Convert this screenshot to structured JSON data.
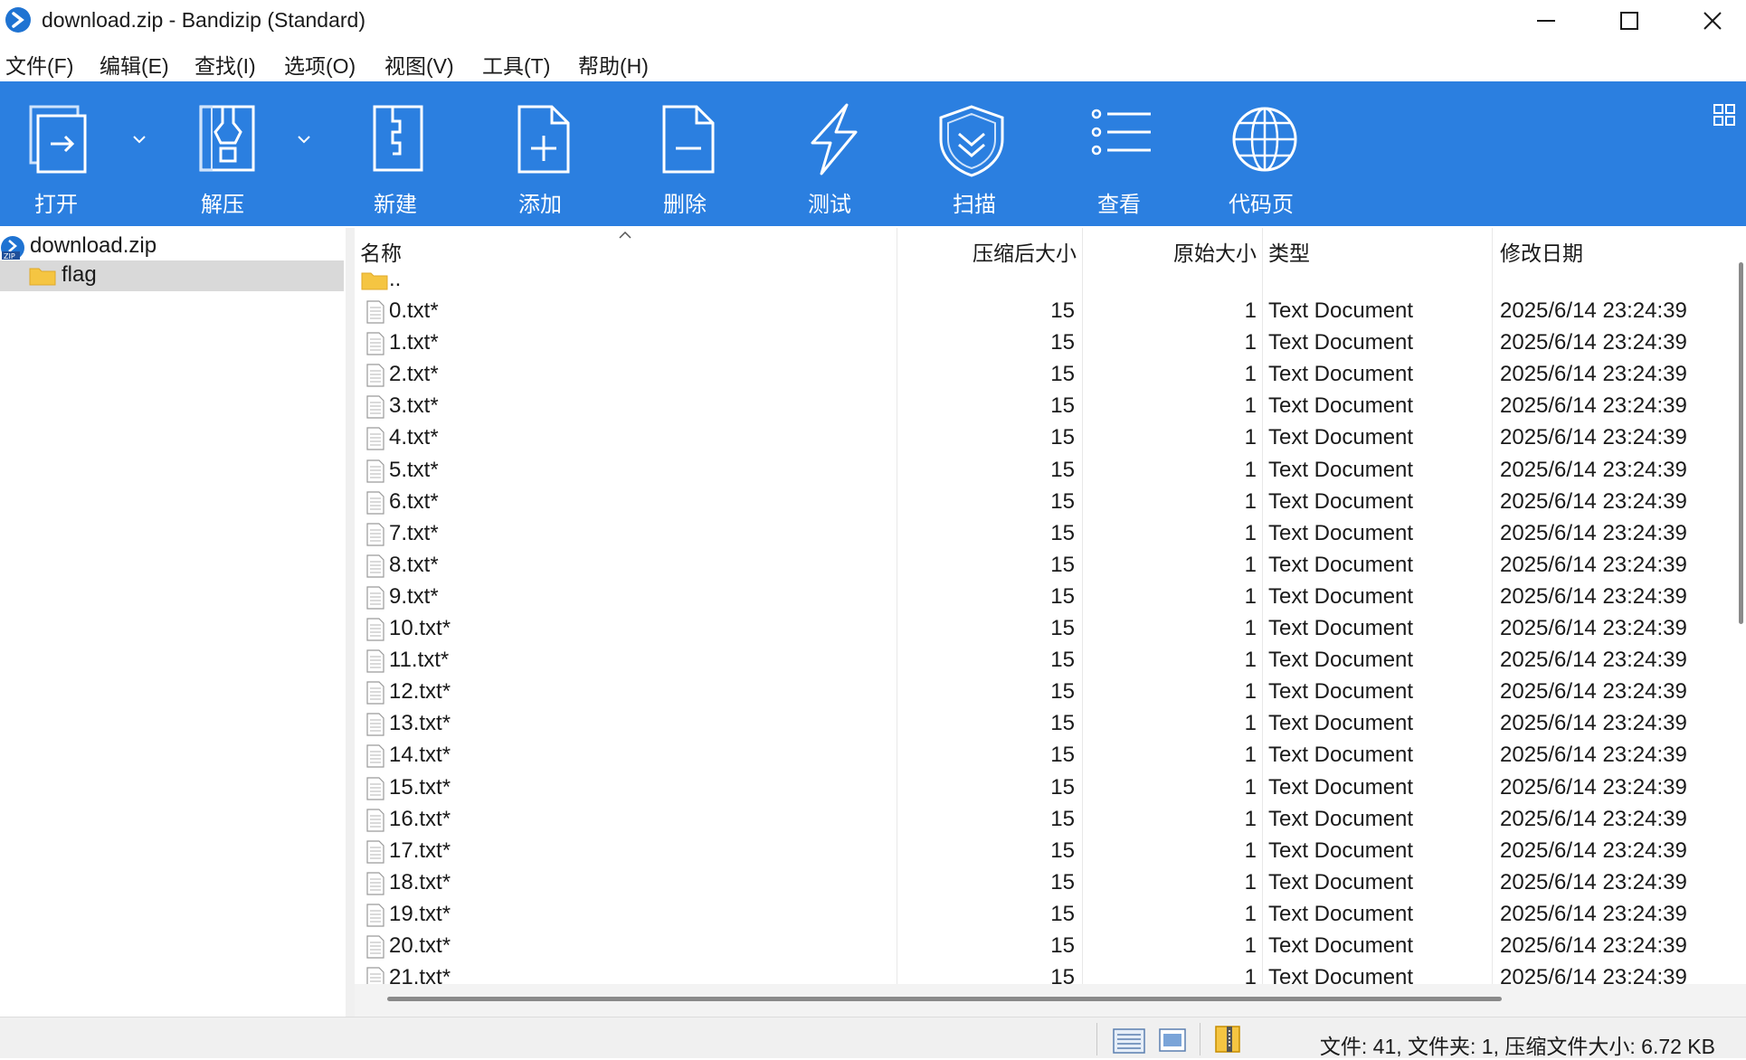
{
  "window": {
    "title": "download.zip - Bandizip (Standard)"
  },
  "menu": [
    "文件(F)",
    "编辑(E)",
    "查找(I)",
    "选项(O)",
    "视图(V)",
    "工具(T)",
    "帮助(H)"
  ],
  "toolbar": {
    "open": "打开",
    "extract": "解压",
    "new": "新建",
    "add": "添加",
    "delete": "删除",
    "test": "测试",
    "scan": "扫描",
    "view": "查看",
    "codepage": "代码页"
  },
  "tree": {
    "root": "download.zip",
    "folder": "flag"
  },
  "columns": {
    "name": "名称",
    "compressed": "压缩后大小",
    "original": "原始大小",
    "type": "类型",
    "modified": "修改日期"
  },
  "parent_dir": "..",
  "files": [
    {
      "name": "0.txt*",
      "compressed": "15",
      "original": "1",
      "type": "Text Document",
      "modified": "2025/6/14 23:24:39"
    },
    {
      "name": "1.txt*",
      "compressed": "15",
      "original": "1",
      "type": "Text Document",
      "modified": "2025/6/14 23:24:39"
    },
    {
      "name": "2.txt*",
      "compressed": "15",
      "original": "1",
      "type": "Text Document",
      "modified": "2025/6/14 23:24:39"
    },
    {
      "name": "3.txt*",
      "compressed": "15",
      "original": "1",
      "type": "Text Document",
      "modified": "2025/6/14 23:24:39"
    },
    {
      "name": "4.txt*",
      "compressed": "15",
      "original": "1",
      "type": "Text Document",
      "modified": "2025/6/14 23:24:39"
    },
    {
      "name": "5.txt*",
      "compressed": "15",
      "original": "1",
      "type": "Text Document",
      "modified": "2025/6/14 23:24:39"
    },
    {
      "name": "6.txt*",
      "compressed": "15",
      "original": "1",
      "type": "Text Document",
      "modified": "2025/6/14 23:24:39"
    },
    {
      "name": "7.txt*",
      "compressed": "15",
      "original": "1",
      "type": "Text Document",
      "modified": "2025/6/14 23:24:39"
    },
    {
      "name": "8.txt*",
      "compressed": "15",
      "original": "1",
      "type": "Text Document",
      "modified": "2025/6/14 23:24:39"
    },
    {
      "name": "9.txt*",
      "compressed": "15",
      "original": "1",
      "type": "Text Document",
      "modified": "2025/6/14 23:24:39"
    },
    {
      "name": "10.txt*",
      "compressed": "15",
      "original": "1",
      "type": "Text Document",
      "modified": "2025/6/14 23:24:39"
    },
    {
      "name": "11.txt*",
      "compressed": "15",
      "original": "1",
      "type": "Text Document",
      "modified": "2025/6/14 23:24:39"
    },
    {
      "name": "12.txt*",
      "compressed": "15",
      "original": "1",
      "type": "Text Document",
      "modified": "2025/6/14 23:24:39"
    },
    {
      "name": "13.txt*",
      "compressed": "15",
      "original": "1",
      "type": "Text Document",
      "modified": "2025/6/14 23:24:39"
    },
    {
      "name": "14.txt*",
      "compressed": "15",
      "original": "1",
      "type": "Text Document",
      "modified": "2025/6/14 23:24:39"
    },
    {
      "name": "15.txt*",
      "compressed": "15",
      "original": "1",
      "type": "Text Document",
      "modified": "2025/6/14 23:24:39"
    },
    {
      "name": "16.txt*",
      "compressed": "15",
      "original": "1",
      "type": "Text Document",
      "modified": "2025/6/14 23:24:39"
    },
    {
      "name": "17.txt*",
      "compressed": "15",
      "original": "1",
      "type": "Text Document",
      "modified": "2025/6/14 23:24:39"
    },
    {
      "name": "18.txt*",
      "compressed": "15",
      "original": "1",
      "type": "Text Document",
      "modified": "2025/6/14 23:24:39"
    },
    {
      "name": "19.txt*",
      "compressed": "15",
      "original": "1",
      "type": "Text Document",
      "modified": "2025/6/14 23:24:39"
    },
    {
      "name": "20.txt*",
      "compressed": "15",
      "original": "1",
      "type": "Text Document",
      "modified": "2025/6/14 23:24:39"
    },
    {
      "name": "21.txt*",
      "compressed": "15",
      "original": "1",
      "type": "Text Document",
      "modified": "2025/6/14 23:24:39"
    }
  ],
  "status": {
    "summary": "文件: 41, 文件夹: 1, 压缩文件大小: 6.72 KB"
  },
  "colors": {
    "toolbar": "#2b7fe0",
    "accent": "#1f73d2",
    "folder": "#f5c542"
  }
}
